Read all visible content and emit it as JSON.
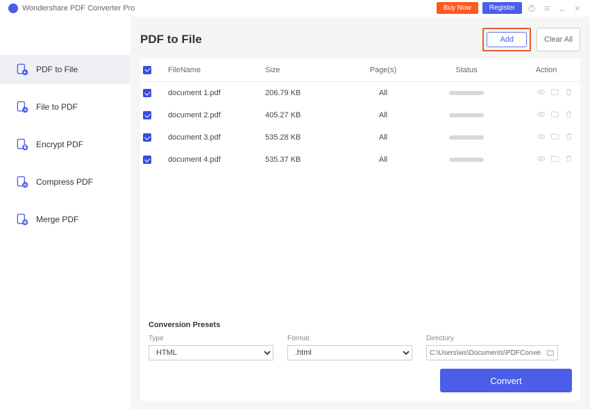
{
  "app": {
    "title": "Wondershare PDF Converter Pro"
  },
  "topbar": {
    "buy": "Buy Now",
    "register": "Register"
  },
  "sidebar": {
    "items": [
      {
        "label": "PDF to File"
      },
      {
        "label": "File to PDF"
      },
      {
        "label": "Encrypt PDF"
      },
      {
        "label": "Compress PDF"
      },
      {
        "label": "Merge PDF"
      }
    ]
  },
  "main": {
    "title": "PDF to File",
    "add": "Add",
    "clear": "Clear All",
    "columns": {
      "filename": "FileName",
      "size": "Size",
      "pages": "Page(s)",
      "status": "Status",
      "action": "Action"
    },
    "rows": [
      {
        "name": "document 1.pdf",
        "size": "206.79 KB",
        "pages": "All"
      },
      {
        "name": "document 2.pdf",
        "size": "405.27 KB",
        "pages": "All"
      },
      {
        "name": "document 3.pdf",
        "size": "535.28 KB",
        "pages": "All"
      },
      {
        "name": "document 4.pdf",
        "size": "535.37 KB",
        "pages": "All"
      }
    ]
  },
  "presets": {
    "title": "Conversion Presets",
    "type_label": "Type",
    "type_value": "HTML",
    "format_label": "Format",
    "format_value": ".html",
    "directory_label": "Directory",
    "directory_value": "C:\\Users\\ws\\Documents\\PDFConvert"
  },
  "convert": "Convert"
}
